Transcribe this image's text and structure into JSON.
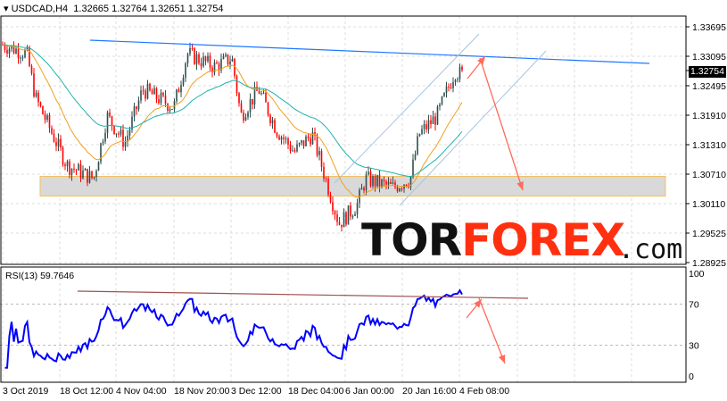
{
  "header": {
    "symbol": "USDCAD,H4",
    "open": "1.32665",
    "high": "1.32764",
    "low": "1.32651",
    "close": "1.32754"
  },
  "current_price": "1.32754",
  "price_axis": [
    "1.33695",
    "1.33095",
    "1.32495",
    "1.31910",
    "1.31310",
    "1.30710",
    "1.30110",
    "1.29525",
    "1.28925"
  ],
  "rsi": {
    "label": "RSI(13) 59.7646",
    "axis": [
      "100",
      "70",
      "30",
      "0"
    ]
  },
  "time_axis": [
    "3 Oct 2019",
    "18 Oct 12:00",
    "4 Nov 04:00",
    "18 Nov 20:00",
    "3 Dec 12:00",
    "18 Dec 04:00",
    "6 Jan 00:00",
    "20 Jan 16:00",
    "4 Feb 08:00"
  ],
  "logo": {
    "part1": "TOR",
    "part2": "FOREX",
    "part3": ".com"
  },
  "colors": {
    "bull": "#2f4f4f",
    "bear": "#ff0000",
    "rsi": "#0000ff",
    "ma_fast": "#f0a020",
    "ma_slow": "#20b2aa",
    "trend": "#1e78ff",
    "arrow": "#ff6a5a"
  },
  "chart_data": {
    "type": "candlestick",
    "price_range": [
      1.28925,
      1.33695
    ],
    "waypoints": [
      1.3333,
      1.3315,
      1.3224,
      1.3088,
      1.306,
      1.3188,
      1.3133,
      1.3242,
      1.3206,
      1.3315,
      1.3288,
      1.3306,
      1.3188,
      1.3242,
      1.316,
      1.3115,
      1.3151,
      1.306,
      1.2969,
      1.3006,
      1.306,
      1.3042,
      1.306,
      1.3151,
      1.3188,
      1.3279,
      1.327
    ],
    "support_zone": [
      1.3025,
      1.3065
    ]
  }
}
